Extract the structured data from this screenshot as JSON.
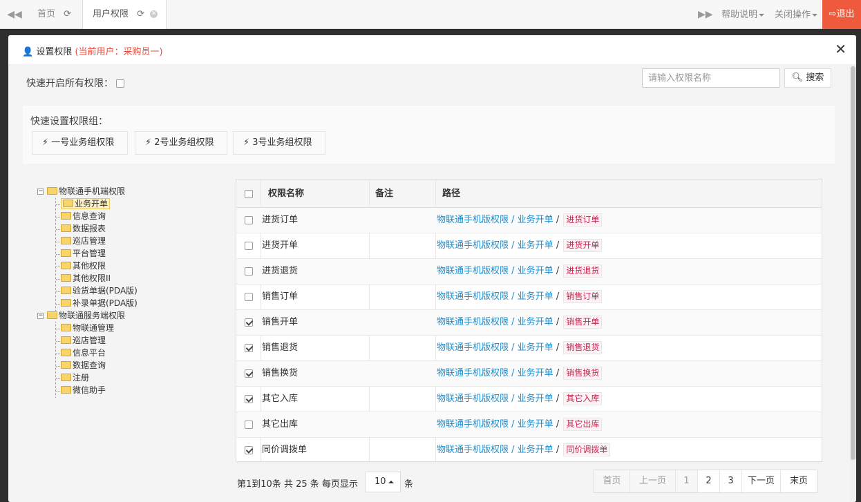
{
  "topbar": {
    "home_tab": "首页",
    "active_tab": "用户权限",
    "help": "帮助说明",
    "close_ops": "关闭操作",
    "exit": "退出"
  },
  "modal": {
    "title": "设置权限",
    "current_user": "(当前用户：采购员一)",
    "quick_all_label": "快速开启所有权限：",
    "search_placeholder": "请输入权限名称",
    "search_button": "搜索",
    "group_title": "快速设置权限组：",
    "groups": [
      "一号业务组权限",
      "2号业务组权限",
      "3号业务组权限"
    ]
  },
  "tree": {
    "root1": "物联通手机端权限",
    "root1_children": [
      "业务开单",
      "信息查询",
      "数据报表",
      "巡店管理",
      "平台管理",
      "其他权限",
      "其他权限II",
      "验货单据(PDA版)",
      "补录单据(PDA版)"
    ],
    "root2": "物联通服务端权限",
    "root2_children": [
      "物联通管理",
      "巡店管理",
      "信息平台",
      "数据查询",
      "注册",
      "微信助手"
    ]
  },
  "table": {
    "headers": {
      "name": "权限名称",
      "note": "备注",
      "path": "路径"
    },
    "path_prefix_1": "物联通手机版权限",
    "path_sep": " / ",
    "path_prefix_2": "业务开单",
    "rows": [
      {
        "name": "进货订单",
        "note": "",
        "checked": false
      },
      {
        "name": "进货开单",
        "note": "",
        "checked": false
      },
      {
        "name": "进货退货",
        "note": "",
        "checked": false
      },
      {
        "name": "销售订单",
        "note": "",
        "checked": false
      },
      {
        "name": "销售开单",
        "note": "",
        "checked": true
      },
      {
        "name": "销售退货",
        "note": "",
        "checked": true
      },
      {
        "name": "销售换货",
        "note": "",
        "checked": true
      },
      {
        "name": "其它入库",
        "note": "",
        "checked": true
      },
      {
        "name": "其它出库",
        "note": "",
        "checked": false
      },
      {
        "name": "同价调拨单",
        "note": "",
        "checked": true
      }
    ]
  },
  "pagination": {
    "info": "第1到10条 共 25 条 每页显示",
    "page_size": "10",
    "unit": "条",
    "first": "首页",
    "prev": "上一页",
    "pages": [
      "1",
      "2",
      "3"
    ],
    "next": "下一页",
    "last": "末页"
  }
}
